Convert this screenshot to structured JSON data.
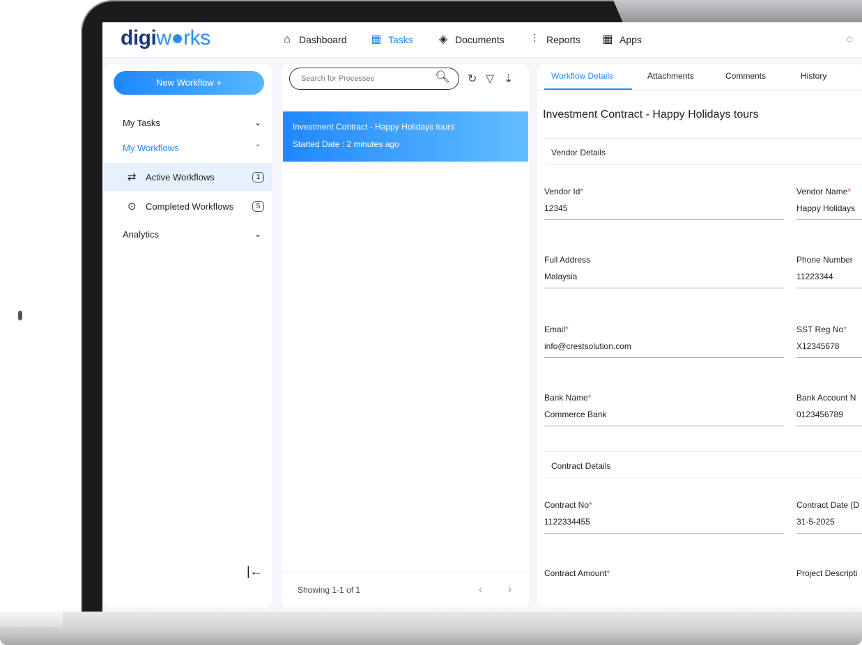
{
  "brand": {
    "part1": "digi",
    "part2": "w",
    "part3": "rks"
  },
  "nav": [
    {
      "label": "Dashboard",
      "icon": "home-icon"
    },
    {
      "label": "Tasks",
      "icon": "tasks-icon",
      "active": true
    },
    {
      "label": "Documents",
      "icon": "layers-icon"
    },
    {
      "label": "Reports",
      "icon": "reports-icon"
    },
    {
      "label": "Apps",
      "icon": "apps-grid-icon"
    }
  ],
  "sidebar": {
    "new_workflow": "New Workflow +",
    "my_tasks": "My Tasks",
    "my_workflows": "My Workflows",
    "active_workflows": "Active Workflows",
    "active_count": "1",
    "completed_workflows": "Completed Workflows",
    "completed_count": "5",
    "analytics": "Analytics"
  },
  "middle": {
    "search_placeholder": "Search for Processes",
    "process_title": "Investment Contract - Happy Holidays tours",
    "process_started": "Started Date : 2 minutes ago",
    "showing": "Showing 1-1 of 1"
  },
  "details": {
    "tabs": [
      "Workflow Details",
      "Attachments",
      "Comments",
      "History"
    ],
    "title": "Investment Contract - Happy Holidays tours",
    "vendor_section": "Vendor Details",
    "contract_section": "Contract Details",
    "fields": {
      "vendor_id": {
        "label": "Vendor Id",
        "value": "12345"
      },
      "vendor_name": {
        "label": "Vendor Name",
        "value": "Happy Holidays"
      },
      "full_address": {
        "label": "Full Address",
        "value": "Malaysia"
      },
      "phone_number": {
        "label": "Phone Number",
        "value": "11223344"
      },
      "email": {
        "label": "Email",
        "value": "info@crestsolution.com"
      },
      "sst_reg_no": {
        "label": "SST Reg No",
        "value": "X12345678"
      },
      "bank_name": {
        "label": "Bank Name",
        "value": "Commerce Bank"
      },
      "bank_account": {
        "label": "Bank Account N",
        "value": "0123456789"
      },
      "contract_no": {
        "label": "Contract No",
        "value": "1122334455"
      },
      "contract_date": {
        "label": "Contract Date (D",
        "value": "31-5-2025"
      },
      "contract_amount": {
        "label": "Contract Amount",
        "value": ""
      },
      "project_description": {
        "label": "Project Descripti",
        "value": ""
      }
    }
  }
}
